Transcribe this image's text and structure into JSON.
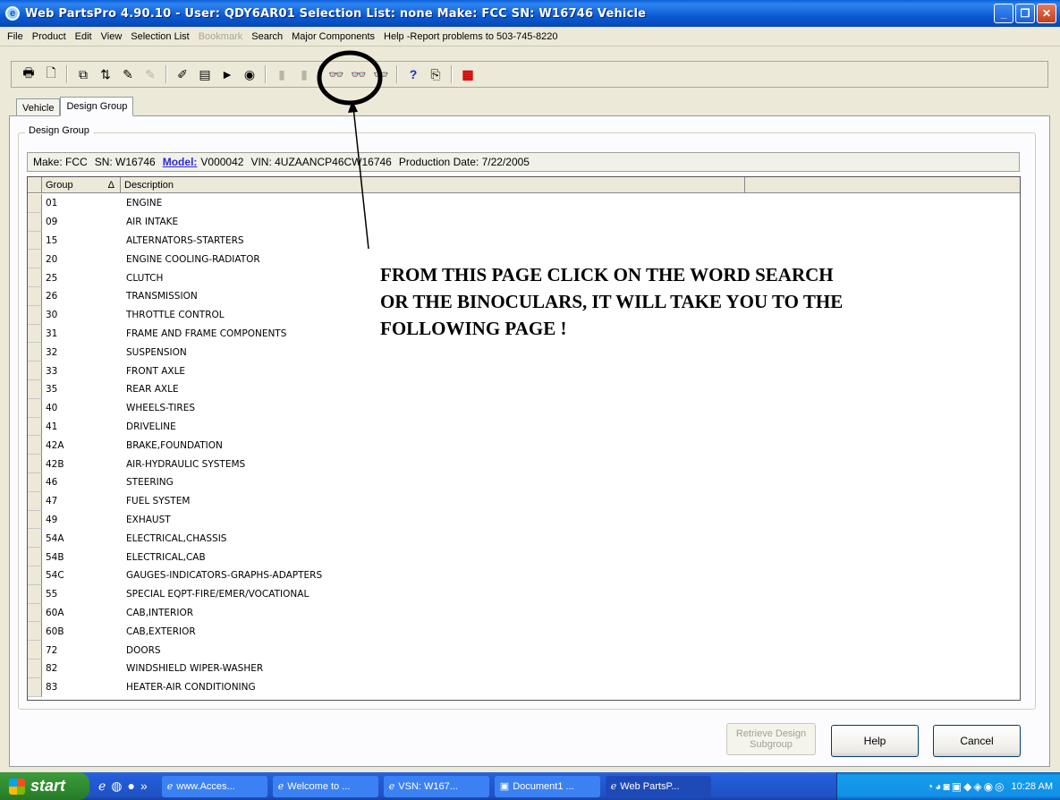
{
  "window": {
    "title": "Web PartsPro 4.90.10 - User: QDY6AR01  Selection List: none  Make: FCC  SN: W16746  Vehicle",
    "controls": [
      "_",
      "❐",
      "✕"
    ]
  },
  "menu": {
    "items": [
      {
        "label": "File",
        "disabled": false
      },
      {
        "label": "Product",
        "disabled": false
      },
      {
        "label": "Edit",
        "disabled": false
      },
      {
        "label": "View",
        "disabled": false
      },
      {
        "label": "Selection List",
        "disabled": false
      },
      {
        "label": "Bookmark",
        "disabled": true
      },
      {
        "label": "Search",
        "disabled": false
      },
      {
        "label": "Major Components",
        "disabled": false
      },
      {
        "label": "Help -Report problems to 503-745-8220",
        "disabled": false
      }
    ]
  },
  "tabs": [
    {
      "label": "Vehicle"
    },
    {
      "label": "Design Group"
    }
  ],
  "groupbox": {
    "label": "Design Group"
  },
  "info": {
    "make": "Make: FCC",
    "sn": "SN: W16746",
    "model_label": "Model:",
    "model_value": "V000042",
    "vin": "VIN: 4UZAANCP46CW16746",
    "production": "Production Date: 7/22/2005"
  },
  "grid": {
    "headers": {
      "group": "Group",
      "sort": "Δ",
      "description": "Description"
    },
    "rows": [
      {
        "group": "01",
        "description": "ENGINE"
      },
      {
        "group": "09",
        "description": "AIR INTAKE"
      },
      {
        "group": "15",
        "description": "ALTERNATORS-STARTERS"
      },
      {
        "group": "20",
        "description": "ENGINE COOLING-RADIATOR"
      },
      {
        "group": "25",
        "description": "CLUTCH"
      },
      {
        "group": "26",
        "description": "TRANSMISSION"
      },
      {
        "group": "30",
        "description": "THROTTLE CONTROL"
      },
      {
        "group": "31",
        "description": "FRAME AND FRAME COMPONENTS"
      },
      {
        "group": "32",
        "description": "SUSPENSION"
      },
      {
        "group": "33",
        "description": "FRONT AXLE"
      },
      {
        "group": "35",
        "description": "REAR AXLE"
      },
      {
        "group": "40",
        "description": "WHEELS-TIRES"
      },
      {
        "group": "41",
        "description": "DRIVELINE"
      },
      {
        "group": "42A",
        "description": "BRAKE,FOUNDATION"
      },
      {
        "group": "42B",
        "description": "AIR-HYDRAULIC SYSTEMS"
      },
      {
        "group": "46",
        "description": "STEERING"
      },
      {
        "group": "47",
        "description": "FUEL SYSTEM"
      },
      {
        "group": "49",
        "description": "EXHAUST"
      },
      {
        "group": "54A",
        "description": "ELECTRICAL,CHASSIS"
      },
      {
        "group": "54B",
        "description": "ELECTRICAL,CAB"
      },
      {
        "group": "54C",
        "description": "GAUGES-INDICATORS-GRAPHS-ADAPTERS"
      },
      {
        "group": "55",
        "description": "SPECIAL EQPT-FIRE/EMER/VOCATIONAL"
      },
      {
        "group": "60A",
        "description": "CAB,INTERIOR"
      },
      {
        "group": "60B",
        "description": "CAB,EXTERIOR"
      },
      {
        "group": "72",
        "description": "DOORS"
      },
      {
        "group": "82",
        "description": "WINDSHIELD WIPER-WASHER"
      },
      {
        "group": "83",
        "description": "HEATER-AIR CONDITIONING"
      }
    ]
  },
  "annotation": {
    "line1": "FROM THIS PAGE CLICK ON THE WORD SEARCH",
    "line2": "OR THE BINOCULARS, IT WILL TAKE YOU TO THE",
    "line3": "FOLLOWING PAGE !"
  },
  "buttons": {
    "retrieve_line1": "Retrieve Design",
    "retrieve_line2": "Subgroup",
    "help": "Help",
    "cancel": "Cancel"
  },
  "taskbar": {
    "start": "start",
    "tasks": [
      {
        "label": "www.Acces..."
      },
      {
        "label": "Welcome to ..."
      },
      {
        "label": "VSN: W167..."
      },
      {
        "label": "Document1 ..."
      },
      {
        "label": "Web PartsP..."
      }
    ],
    "clock": "10:28 AM"
  }
}
